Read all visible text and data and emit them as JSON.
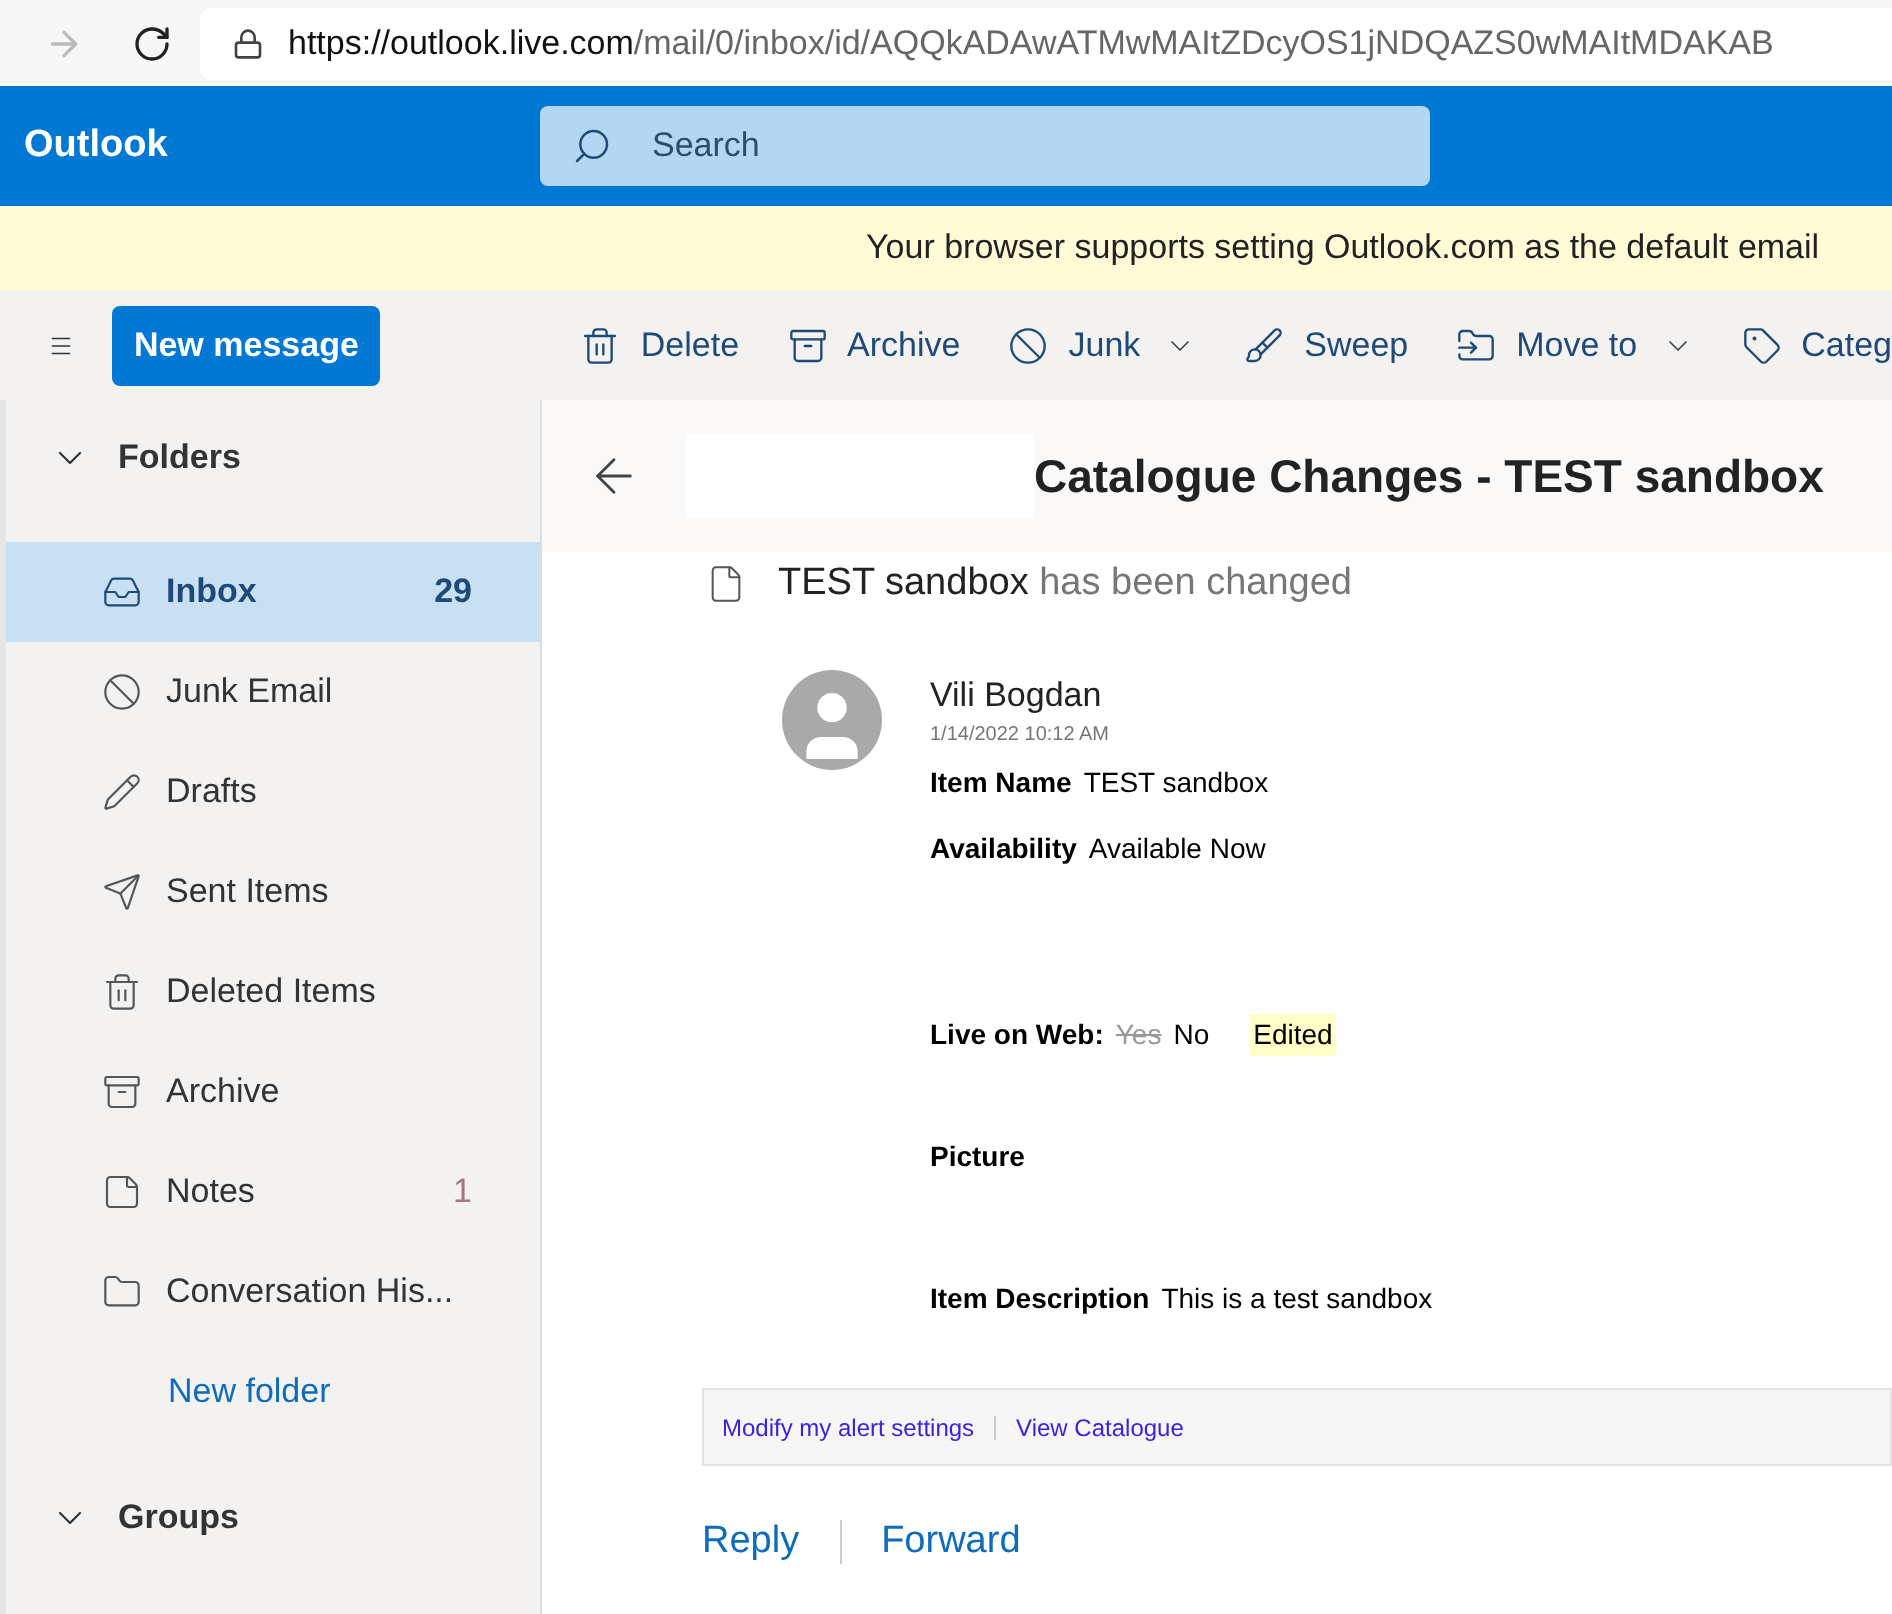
{
  "browser": {
    "url_host": "https://outlook.live.com",
    "url_path": "/mail/0/inbox/id/AQQkADAwATMwMAItZDcyOS1jNDQAZS0wMAItMDAKAB"
  },
  "header": {
    "app_name": "Outlook",
    "search": {
      "placeholder": "Search"
    }
  },
  "banner": {
    "text": "Your browser supports setting Outlook.com as the default email"
  },
  "toolbar": {
    "new_message": "New message",
    "actions": [
      {
        "label": "Delete",
        "dropdown": false
      },
      {
        "label": "Archive",
        "dropdown": false
      },
      {
        "label": "Junk",
        "dropdown": true
      },
      {
        "label": "Sweep",
        "dropdown": false
      },
      {
        "label": "Move to",
        "dropdown": true
      },
      {
        "label": "Categ",
        "dropdown": false
      }
    ]
  },
  "sidebar": {
    "folders_heading": "Folders",
    "folders_expanded": true,
    "folders": [
      {
        "label": "Inbox",
        "count": "29",
        "selected": true
      },
      {
        "label": "Junk Email",
        "selected": false
      },
      {
        "label": "Drafts",
        "selected": false
      },
      {
        "label": "Sent Items",
        "selected": false
      },
      {
        "label": "Deleted Items",
        "selected": false
      },
      {
        "label": "Archive",
        "selected": false
      },
      {
        "label": "Notes",
        "count": "1",
        "selected": false
      },
      {
        "label": "Conversation His...",
        "selected": false
      }
    ],
    "new_folder": "New folder",
    "groups_heading": "Groups",
    "groups_expanded": true
  },
  "message": {
    "subject": "Catalogue Changes - TEST sandbox",
    "summary_item": "TEST sandbox",
    "summary_rest": "has been changed",
    "sender": "Vili Bogdan",
    "date": "1/14/2022 10:12 AM",
    "fields": [
      {
        "kind": "plain",
        "label": "Item Name",
        "value": "TEST sandbox"
      },
      {
        "kind": "plain",
        "label": "Availability",
        "value": "Available Now"
      },
      {
        "kind": "change",
        "label": "Live on Web:",
        "old_value": "Yes",
        "value": "No",
        "badge": "Edited"
      },
      {
        "kind": "plain",
        "label": "Picture"
      },
      {
        "kind": "plain",
        "label": "Item Description",
        "value": "This is a test sandbox"
      }
    ],
    "footer_links": [
      "Modify my alert settings",
      "View Catalogue"
    ],
    "actions": [
      "Reply",
      "Forward"
    ]
  }
}
